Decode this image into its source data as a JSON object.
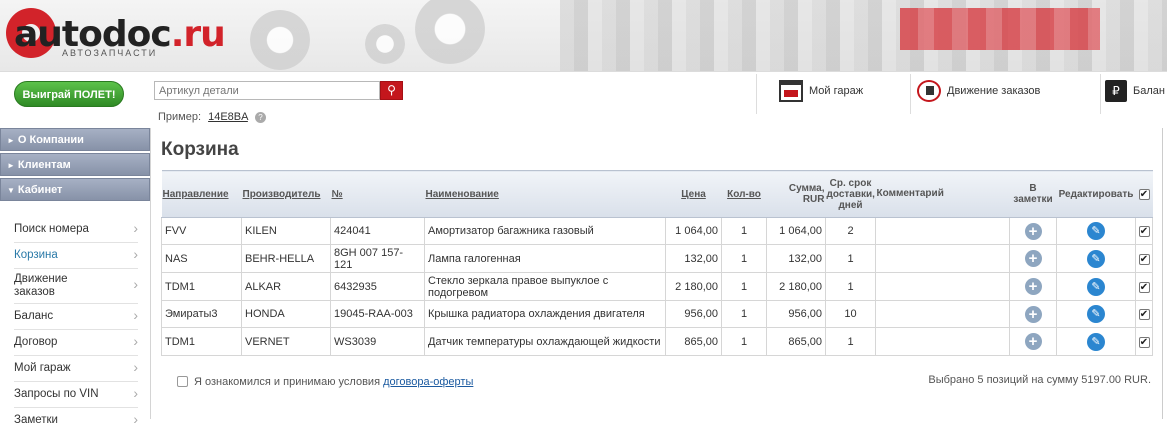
{
  "header": {
    "logo_text": "autodoc",
    "logo_tld": ".ru",
    "logo_subtitle": "АВТОЗАПЧАСТИ"
  },
  "toolbar": {
    "promo_button": "Выиграй ПОЛЕТ!",
    "search_placeholder": "Артикул детали",
    "example_label": "Пример:",
    "example_code": "14E8BA",
    "links": {
      "garage": "Мой гараж",
      "orders": "Движение заказов",
      "balance": "Балан"
    }
  },
  "sidebar": {
    "sections": [
      "О Компании",
      "Клиентам",
      "Кабинет"
    ],
    "items": [
      "Поиск номера",
      "Корзина",
      "Движение заказов",
      "Баланс",
      "Договор",
      "Мой гараж",
      "Запросы по VIN",
      "Заметки"
    ],
    "active_item": "Корзина"
  },
  "main": {
    "title": "Корзина",
    "columns": {
      "direction": "Направление",
      "manufacturer": "Производитель",
      "number": "№",
      "name": "Наименование",
      "price": "Цена",
      "qty": "Кол-во",
      "sum": "Сумма, RUR",
      "delivery": "Ср. срок доставки, дней",
      "comment": "Комментарий",
      "notes": "В заметки",
      "edit": "Редактировать"
    },
    "rows": [
      {
        "direction": "FVV",
        "manufacturer": "KILEN",
        "number": "424041",
        "name": "Амортизатор багажника газовый",
        "price": "1 064,00",
        "qty": "1",
        "sum": "1 064,00",
        "delivery": "2",
        "comment": ""
      },
      {
        "direction": "NAS",
        "manufacturer": "BEHR-HELLA",
        "number": "8GH 007 157-121",
        "name": "Лампа галогенная",
        "price": "132,00",
        "qty": "1",
        "sum": "132,00",
        "delivery": "1",
        "comment": ""
      },
      {
        "direction": "TDM1",
        "manufacturer": "ALKAR",
        "number": "6432935",
        "name": "Стекло зеркала правое выпуклое с подогревом",
        "price": "2 180,00",
        "qty": "1",
        "sum": "2 180,00",
        "delivery": "1",
        "comment": ""
      },
      {
        "direction": "Эмираты3",
        "manufacturer": "HONDA",
        "number": "19045-RAA-003",
        "name": "Крышка радиатора охлаждения двигателя",
        "price": "956,00",
        "qty": "1",
        "sum": "956,00",
        "delivery": "10",
        "comment": ""
      },
      {
        "direction": "TDM1",
        "manufacturer": "VERNET",
        "number": "WS3039",
        "name": "Датчик температуры охлаждающей жидкости",
        "price": "865,00",
        "qty": "1",
        "sum": "865,00",
        "delivery": "1",
        "comment": ""
      }
    ],
    "terms_text": "Я ознакомился и принимаю условия",
    "terms_link": "договора-оферты",
    "summary": "Выбрано 5 позиций на сумму 5197.00 RUR."
  },
  "icons": {
    "search": "search-icon",
    "add_note": "plus-icon",
    "edit": "pencil-icon",
    "checkbox": "checkbox-icon"
  },
  "colors": {
    "brand_red": "#c4161c",
    "promo_green": "#3fa02f",
    "sidebar_header": "#8f9ab0",
    "link_blue": "#1b5aa0"
  }
}
